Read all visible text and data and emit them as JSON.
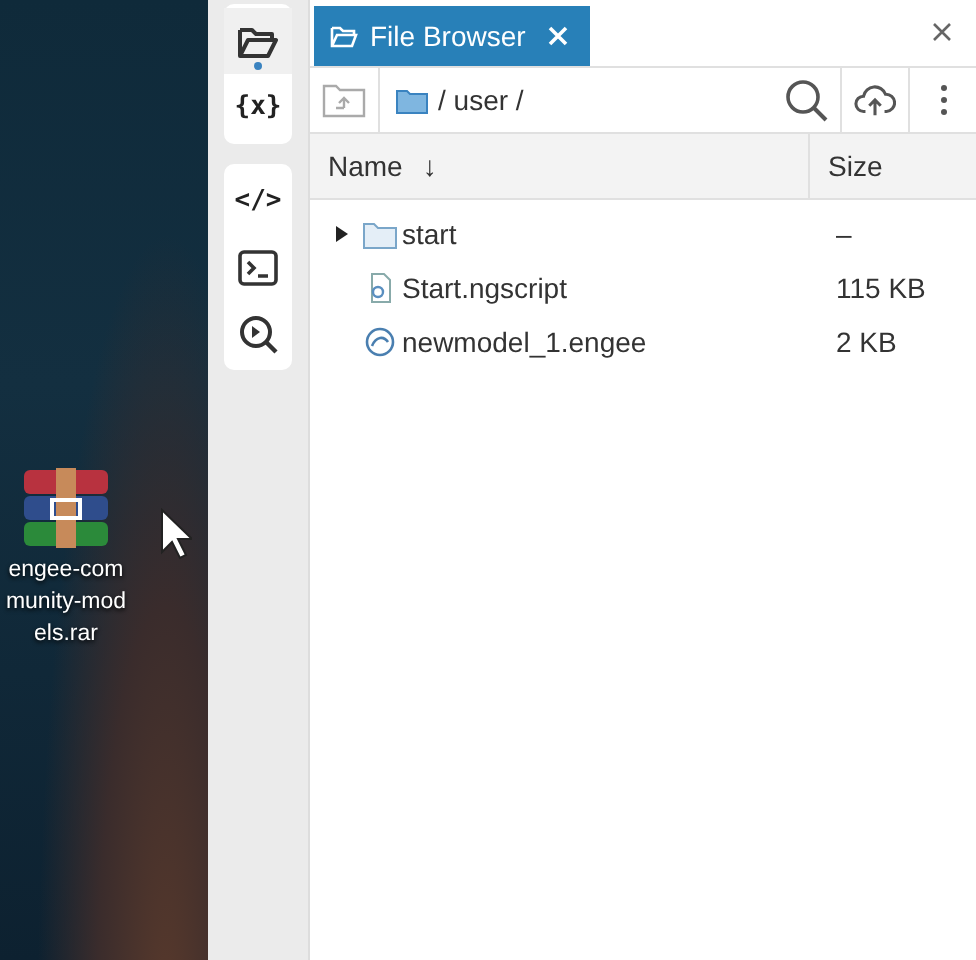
{
  "desktop": {
    "file": {
      "label": "engee-community-models.rar"
    }
  },
  "sidebar": {
    "groups": [
      {
        "items": [
          {
            "kind": "folder",
            "selected": true
          },
          {
            "kind": "glyph",
            "glyph": "{x}",
            "selected": false
          }
        ]
      },
      {
        "items": [
          {
            "kind": "glyph",
            "glyph": "</>",
            "selected": false
          },
          {
            "kind": "terminal",
            "selected": false
          },
          {
            "kind": "inspect",
            "selected": false
          }
        ]
      }
    ]
  },
  "tabs": [
    {
      "label": "File Browser",
      "selected": true
    }
  ],
  "toolbar": {
    "path": "/ user /"
  },
  "table": {
    "columns": [
      {
        "label": "Name",
        "sort_mark": "↓"
      },
      {
        "label": "Size"
      }
    ],
    "rows": [
      {
        "kind": "folder",
        "name": "start",
        "size": "–"
      },
      {
        "kind": "script",
        "name": "Start.ngscript",
        "size": "115 KB"
      },
      {
        "kind": "model",
        "name": "newmodel_1.engee",
        "size": "2 KB"
      }
    ]
  }
}
